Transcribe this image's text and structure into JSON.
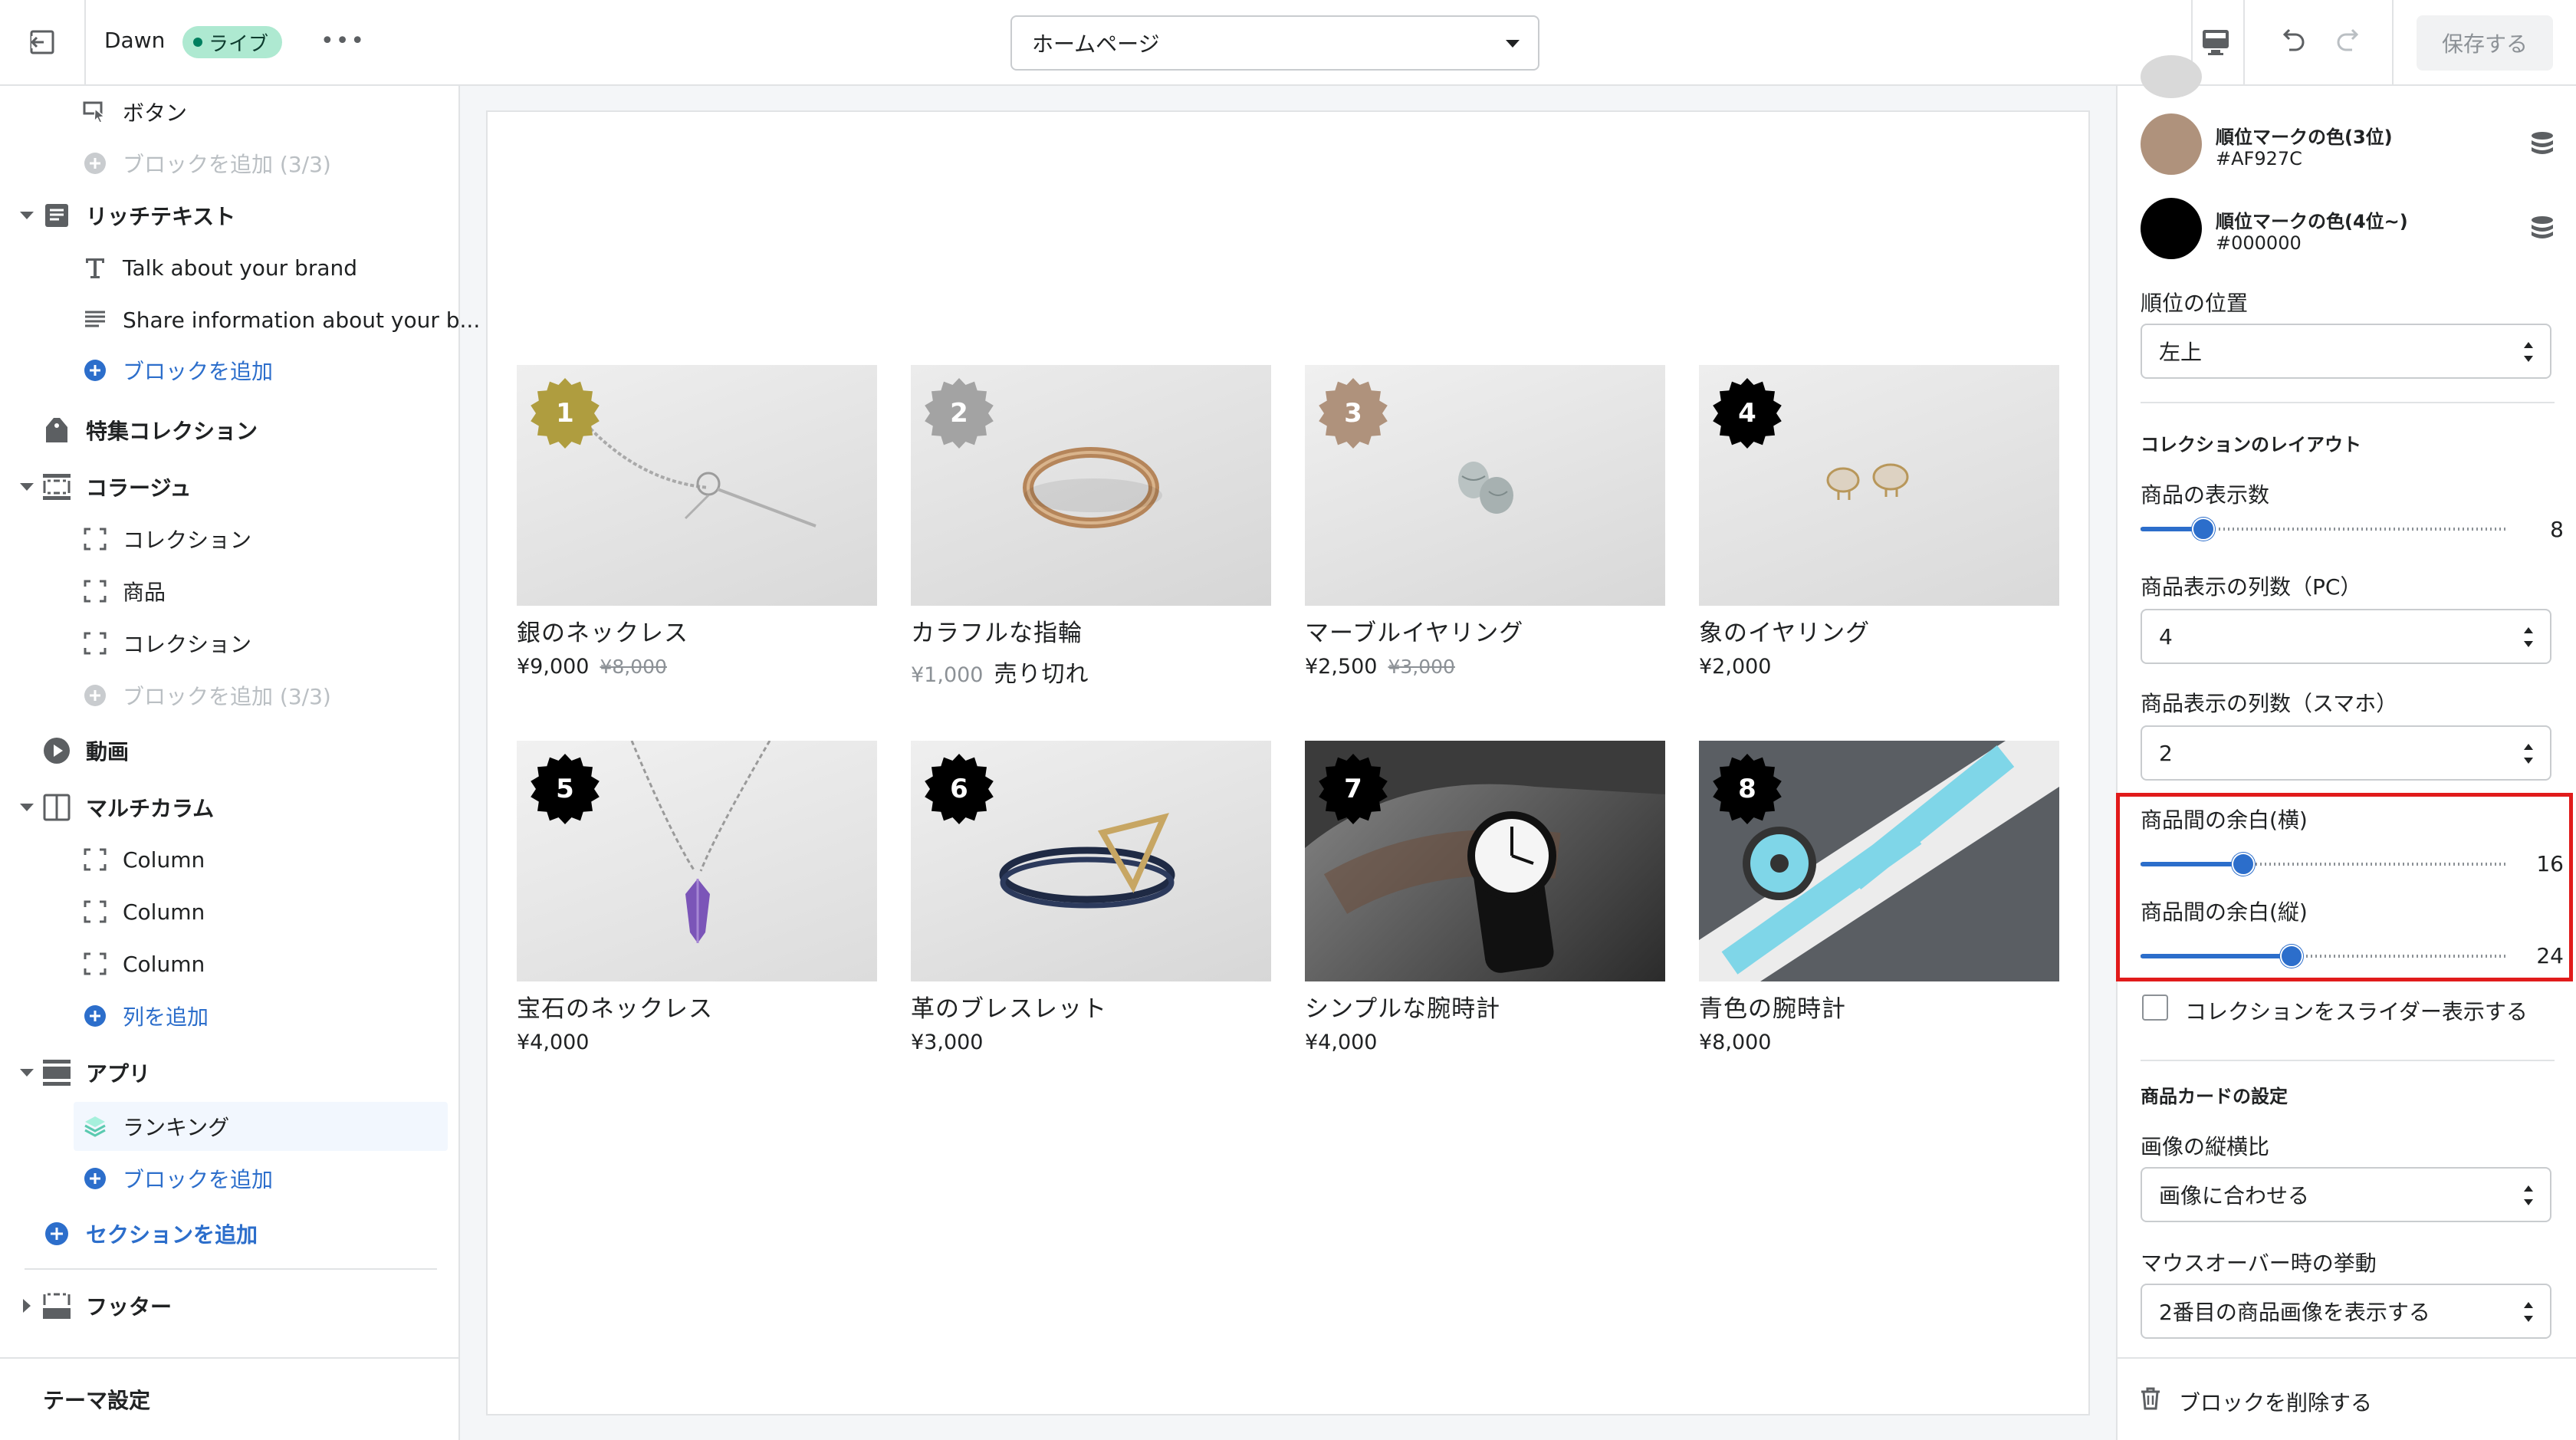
{
  "topbar": {
    "theme_name": "Dawn",
    "live_badge": "ライブ",
    "more": "•••",
    "page_select": "ホームページ",
    "save_label": "保存する"
  },
  "sidebar": {
    "rows": {
      "button_block": "ボタン",
      "add_block_disabled_1": "ブロックを追加 (3/3)",
      "rich_text": "リッチテキスト",
      "talk_about_brand": "Talk about your brand",
      "share_info": "Share information about your b...",
      "add_block_1": "ブロックを追加",
      "featured_collection": "特集コレクション",
      "collage": "コラージュ",
      "collection_1": "コレクション",
      "product": "商品",
      "collection_2": "コレクション",
      "add_block_disabled_2": "ブロックを追加 (3/3)",
      "video": "動画",
      "multicolumn": "マルチカラム",
      "column_1": "Column",
      "column_2": "Column",
      "column_3": "Column",
      "add_column": "列を追加",
      "apps": "アプリ",
      "ranking": "ランキング",
      "add_block_2": "ブロックを追加",
      "add_section": "セクションを追加",
      "footer": "フッター"
    },
    "theme_settings": "テーマ設定"
  },
  "preview": {
    "products": [
      {
        "rank": "1",
        "name": "銀のネックレス",
        "price": "¥9,000",
        "compare": "¥8,000"
      },
      {
        "rank": "2",
        "name": "カラフルな指輪",
        "price": "¥1,000",
        "sold_out": "売り切れ"
      },
      {
        "rank": "3",
        "name": "マーブルイヤリング",
        "price": "¥2,500",
        "compare": "¥3,000"
      },
      {
        "rank": "4",
        "name": "象のイヤリング",
        "price": "¥2,000"
      },
      {
        "rank": "5",
        "name": "宝石のネックレス",
        "price": "¥4,000"
      },
      {
        "rank": "6",
        "name": "革のブレスレット",
        "price": "¥3,000"
      },
      {
        "rank": "7",
        "name": "シンプルな腕時計",
        "price": "¥4,000"
      },
      {
        "rank": "8",
        "name": "青色の腕時計",
        "price": "¥8,000"
      }
    ],
    "rank_colors": [
      "#AF9D3F",
      "#A3A3A3",
      "#AF927C",
      "#000000",
      "#000000",
      "#000000",
      "#000000",
      "#000000"
    ]
  },
  "settings": {
    "rank3_color_label": "順位マークの色(3位)",
    "rank3_color_hex": "#AF927C",
    "rank4_color_label": "順位マークの色(4位~)",
    "rank4_color_hex": "#000000",
    "rank_position_label": "順位の位置",
    "rank_position_value": "左上",
    "collection_layout_heading": "コレクションのレイアウト",
    "product_count_label": "商品の表示数",
    "product_count_value": "8",
    "product_count_fraction": 0.17,
    "columns_pc_label": "商品表示の列数（PC）",
    "columns_pc_value": "4",
    "columns_mobile_label": "商品表示の列数（スマホ）",
    "columns_mobile_value": "2",
    "gap_h_label": "商品間の余白(横)",
    "gap_h_value": "16",
    "gap_h_fraction": 0.28,
    "gap_v_label": "商品間の余白(縦)",
    "gap_v_value": "24",
    "gap_v_fraction": 0.41,
    "slider_display_label": "コレクションをスライダー表示する",
    "card_settings_heading": "商品カードの設定",
    "aspect_ratio_label": "画像の縦横比",
    "aspect_ratio_value": "画像に合わせる",
    "hover_label": "マウスオーバー時の挙動",
    "hover_value": "2番目の商品画像を表示する",
    "delete_block": "ブロックを削除する"
  }
}
